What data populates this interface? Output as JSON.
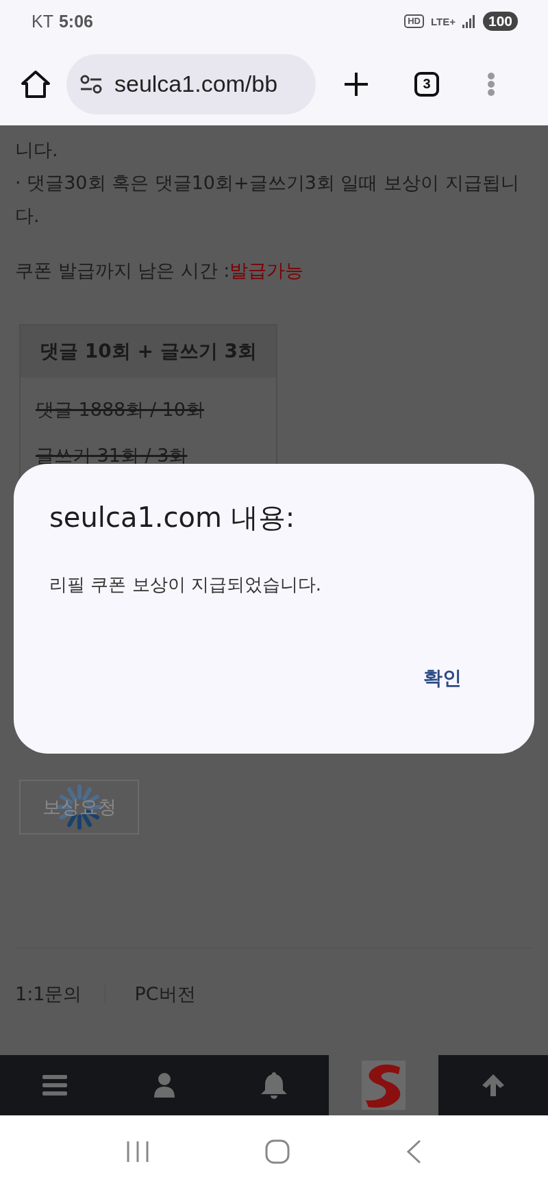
{
  "status_bar": {
    "carrier": "KT",
    "time": "5:06",
    "volte": "HD",
    "network": "LTE+",
    "battery": "100"
  },
  "browser": {
    "url": "seulca1.com/bb",
    "tab_count": "3"
  },
  "page": {
    "lines": [
      "니다.",
      "· 댓글30회 혹은 댓글10회+글쓰기3회 일때 보상이 지급됩니",
      "다."
    ],
    "coupon_label": "쿠폰 발급까지 남은 시간 : ",
    "coupon_status": "발급가능",
    "table": {
      "header": "댓글 10회 + 글쓰기 3회",
      "rows": [
        {
          "text": "댓글 1888회 / 10회",
          "done": true
        },
        {
          "text": "글쓰기 31회 / 3회",
          "done": true
        }
      ]
    },
    "request_button": {
      "label": "보상요청",
      "loading": true
    },
    "footer_links": [
      "1:1문의",
      "PC버전"
    ]
  },
  "dialog": {
    "title": "seulca1.com 내용:",
    "message": "리필 쿠폰 보상이 지급되었습니다.",
    "button": "확인"
  },
  "bottom_nav": [
    {
      "kind": "menu"
    },
    {
      "kind": "user"
    },
    {
      "kind": "bell"
    },
    {
      "kind": "logo"
    },
    {
      "kind": "up"
    }
  ]
}
